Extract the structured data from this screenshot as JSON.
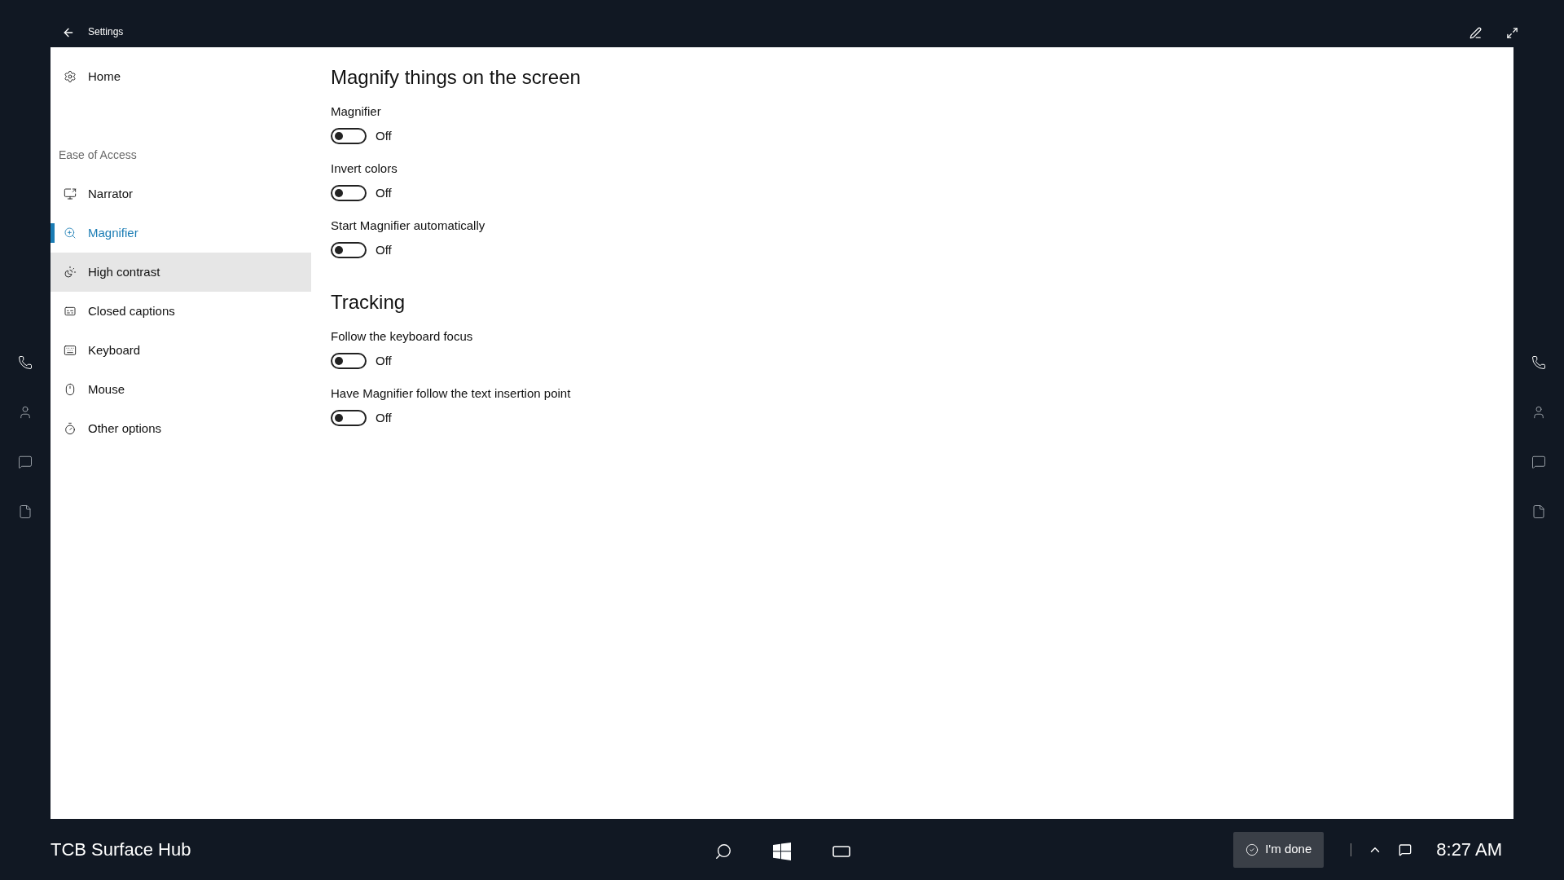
{
  "title_bar": {
    "title": "Settings"
  },
  "sidebar": {
    "home": "Home",
    "section": "Ease of Access",
    "items": [
      {
        "label": "Narrator",
        "kind": "narrator",
        "selected": false,
        "hovered": false
      },
      {
        "label": "Magnifier",
        "kind": "magnifier",
        "selected": true,
        "hovered": false
      },
      {
        "label": "High contrast",
        "kind": "contrast",
        "selected": false,
        "hovered": true
      },
      {
        "label": "Closed captions",
        "kind": "captions",
        "selected": false,
        "hovered": false
      },
      {
        "label": "Keyboard",
        "kind": "keyboard",
        "selected": false,
        "hovered": false
      },
      {
        "label": "Mouse",
        "kind": "mouse",
        "selected": false,
        "hovered": false
      },
      {
        "label": "Other options",
        "kind": "other",
        "selected": false,
        "hovered": false
      }
    ]
  },
  "content": {
    "sections": [
      {
        "heading": "Magnify things on the screen",
        "settings": [
          {
            "label": "Magnifier",
            "on": false,
            "state_text": "Off"
          },
          {
            "label": "Invert colors",
            "on": false,
            "state_text": "Off"
          },
          {
            "label": "Start Magnifier automatically",
            "on": false,
            "state_text": "Off"
          }
        ]
      },
      {
        "heading": "Tracking",
        "settings": [
          {
            "label": "Follow the keyboard focus",
            "on": false,
            "state_text": "Off"
          },
          {
            "label": "Have Magnifier follow the text insertion point",
            "on": false,
            "state_text": "Off"
          }
        ]
      }
    ]
  },
  "taskbar": {
    "device_name": "TCB Surface Hub",
    "done_button": "I'm done",
    "time": "8:27 AM"
  }
}
